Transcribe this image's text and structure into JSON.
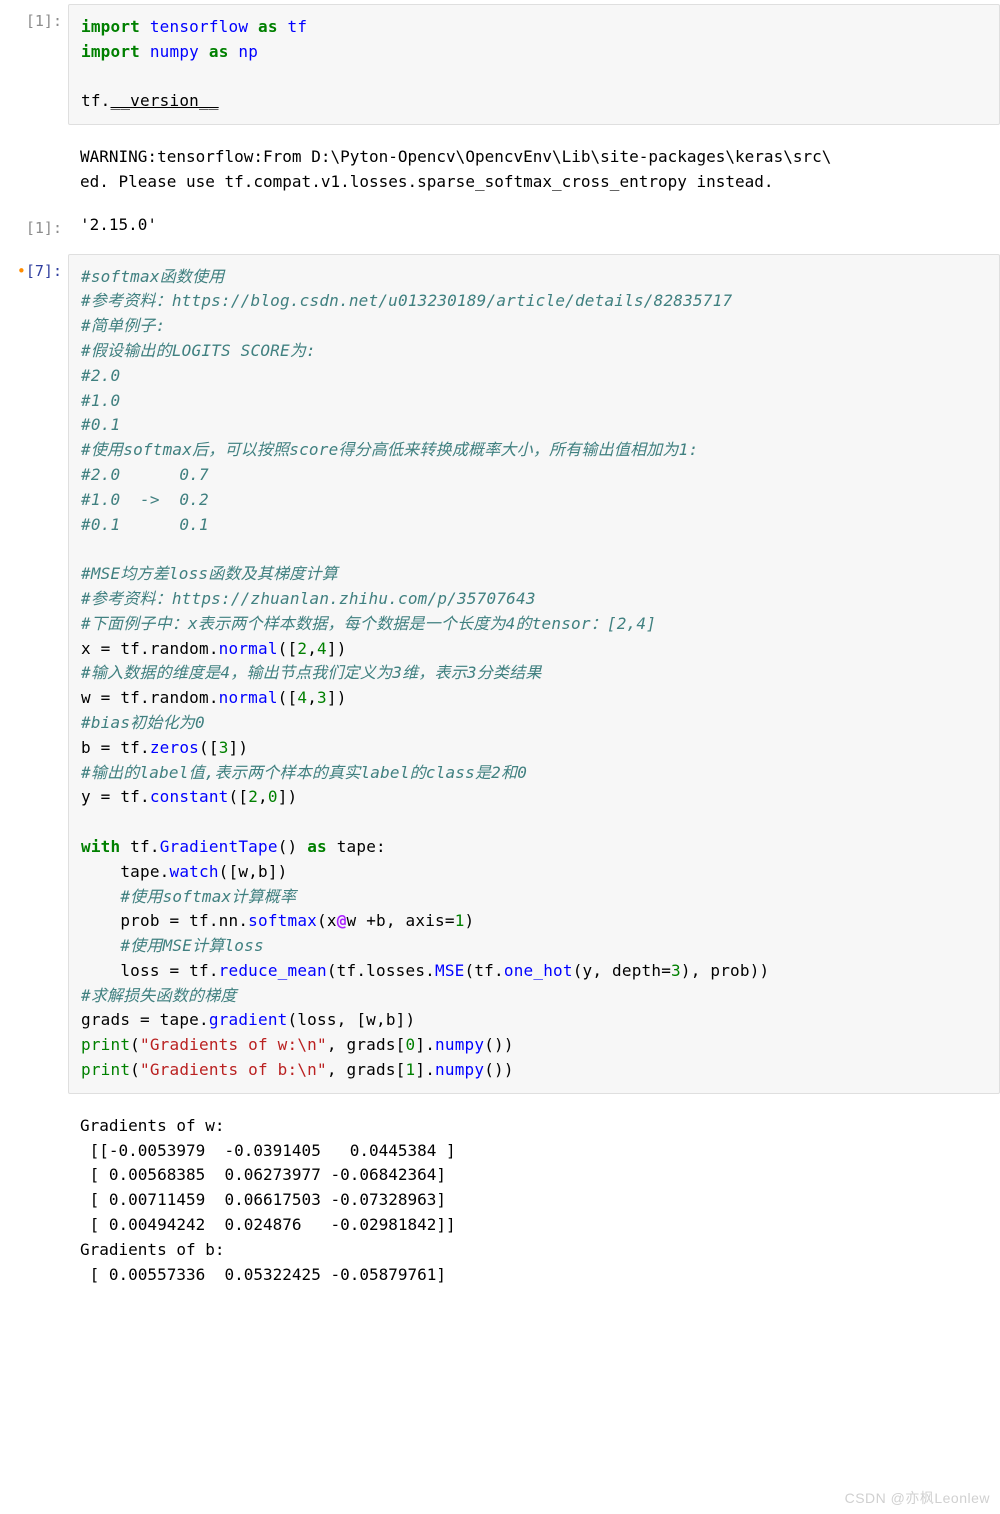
{
  "prompts": {
    "in1": "[1]:",
    "out1": "[1]:",
    "in2_dot": "•",
    "in2": "[7]:"
  },
  "cell1": {
    "l1_import": "import",
    "l1_mod": "tensorflow",
    "l1_as": "as",
    "l1_alias": "tf",
    "l2_import": "import",
    "l2_mod": "numpy",
    "l2_as": "as",
    "l2_alias": "np",
    "l4_obj": "tf.",
    "l4_attr": "__version__"
  },
  "cell1_stderr": "WARNING:tensorflow:From D:\\Pyton-Opencv\\OpencvEnv\\Lib\\site-packages\\keras\\src\\\ned. Please use tf.compat.v1.losses.sparse_softmax_cross_entropy instead.",
  "cell1_result": "'2.15.0'",
  "cell2": {
    "c01": "#softmax函数使用",
    "c02": "#参考资料：https://blog.csdn.net/u013230189/article/details/82835717",
    "c03": "#简单例子:",
    "c04": "#假设输出的LOGITS SCORE为:",
    "c05": "#2.0",
    "c06": "#1.0",
    "c07": "#0.1",
    "c08": "#使用softmax后，可以按照score得分高低来转换成概率大小，所有输出值相加为1:",
    "c09": "#2.0      0.7",
    "c10": "#1.0  ->  0.2",
    "c11": "#0.1      0.1",
    "c12": "#MSE均方差loss函数及其梯度计算",
    "c13": "#参考资料：https://zhuanlan.zhihu.com/p/35707643",
    "c14": "#下面例子中：x表示两个样本数据，每个数据是一个长度为4的tensor：[2,4]",
    "x_assign_pre": "x = tf.random.",
    "x_assign_fn": "normal",
    "x_assign_args_open": "([",
    "x_n1": "2",
    "x_comma": ",",
    "x_n2": "4",
    "x_close": "])",
    "c15": "#输入数据的维度是4，输出节点我们定义为3维，表示3分类结果",
    "w_assign_pre": "w = tf.random.",
    "w_assign_fn": "normal",
    "w_n1": "4",
    "w_n2": "3",
    "c16": "#bias初始化为0",
    "b_assign_pre": "b = tf.",
    "b_assign_fn": "zeros",
    "b_n1": "3",
    "c17": "#输出的label值,表示两个样本的真实label的class是2和0",
    "y_assign_pre": "y = tf.",
    "y_assign_fn": "constant",
    "y_n1": "2",
    "y_n2": "0",
    "with_kw": "with",
    "with_expr1": " tf.",
    "with_fn": "GradientTape",
    "with_paren": "()",
    "with_as": " as",
    "with_var": " tape:",
    "tape_watch_pre": "    tape.",
    "tape_watch_fn": "watch",
    "tape_watch_args": "([w,b])",
    "c18": "    #使用softmax计算概率",
    "prob_pre": "    prob = tf.nn.",
    "prob_fn": "softmax",
    "prob_args_a": "(x",
    "prob_at": "@",
    "prob_args_b": "w +b, axis=",
    "prob_num": "1",
    "prob_args_c": ")",
    "c19": "    #使用MSE计算loss",
    "loss_pre": "    loss = tf.",
    "loss_fn1": "reduce_mean",
    "loss_mid1": "(tf.losses.",
    "loss_fn2": "MSE",
    "loss_mid2": "(tf.",
    "loss_fn3": "one_hot",
    "loss_args": "(y, depth=",
    "loss_depth": "3",
    "loss_tail": "), prob))",
    "c20": "#求解损失函数的梯度",
    "grads_pre": "grads = tape.",
    "grads_fn": "gradient",
    "grads_args": "(loss, [w,b])",
    "p1_pre": "print",
    "p1_open": "(",
    "p1_str": "\"Gradients of w:\\n\"",
    "p1_mid": ", grads[",
    "p1_idx": "0",
    "p1_tail": "].",
    "p1_fn": "numpy",
    "p1_close": "())",
    "p2_str": "\"Gradients of b:\\n\"",
    "p2_idx": "1"
  },
  "cell2_output": "Gradients of w:\n [[-0.0053979  -0.0391405   0.0445384 ]\n [ 0.00568385  0.06273977 -0.06842364]\n [ 0.00711459  0.06617503 -0.07328963]\n [ 0.00494242  0.024876   -0.02981842]]\nGradients of b:\n [ 0.00557336  0.05322425 -0.05879761]",
  "watermark": "CSDN @亦枫Leonlew"
}
